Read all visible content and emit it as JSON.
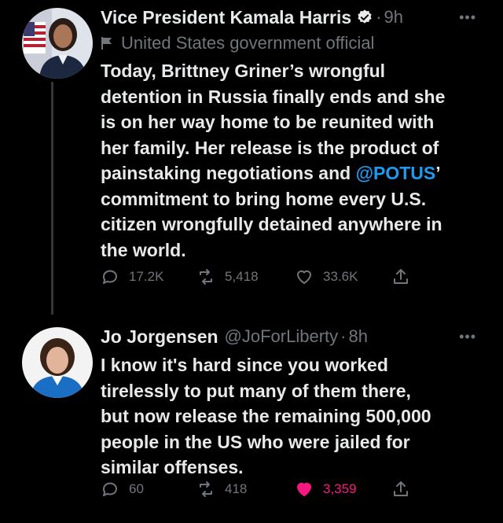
{
  "tweets": [
    {
      "name": "Vice President Kamala Harris",
      "handle": "",
      "time": "9h",
      "label": "United States government official",
      "text_before_mention": "Today, Brittney Griner’s wrongful\ndetention in Russia finally ends and she\nis on her way home to be reunited with\nher family. Her release is the product of\npainstaking negotiations and ",
      "mention": "@POTUS",
      "text_after_mention": "’\ncommitment to bring home every U.S.\ncitizen wrongfully detained anywhere in\nthe world.",
      "replies": "17.2K",
      "retweets": "5,418",
      "likes": "33.6K",
      "verified_icon": "verified-badge-icon",
      "more_icon": "more-icon"
    },
    {
      "name": "Jo Jorgensen",
      "handle": "@JoForLiberty",
      "time": "8h",
      "text": "I know it's hard since you worked\ntirelessly to put many of them there,\nbut now release the remaining 500,000\npeople in the US who were jailed for\nsimilar offenses.",
      "replies": "60",
      "retweets": "418",
      "likes": "3,359",
      "liked": true,
      "more_icon": "more-icon"
    }
  ],
  "colors": {
    "background": "#000000",
    "text": "#e7e9ea",
    "muted": "#71767b",
    "link": "#1d9bf0",
    "like_active": "#f91880"
  }
}
